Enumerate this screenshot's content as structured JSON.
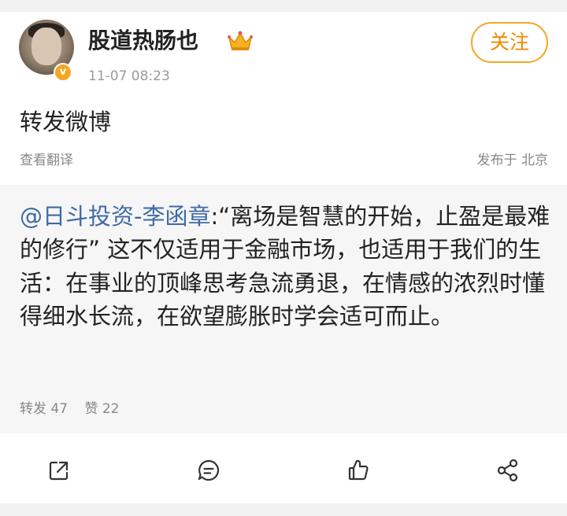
{
  "post": {
    "username": "股道热肠也",
    "timestamp": "11-07 08:23",
    "follow_label": "关注",
    "text": "转发微博",
    "translate_label": "查看翻译",
    "location": "发布于 北京"
  },
  "repost": {
    "mention": "@日斗投资-李函章",
    "body": ":“离场是智慧的开始，止盈是最难的修行” 这不仅适用于金融市场，也适用于我们的生活：在事业的顶峰思考急流勇退，在情感的浓烈时懂得细水长流，在欲望膨胀时学会适可而止。",
    "reposts_label": "转发 47",
    "likes_label": "赞 22"
  },
  "actions": {
    "icons": [
      "share-external-icon",
      "comment-icon",
      "like-icon",
      "share-icon"
    ]
  },
  "colors": {
    "accent": "#f5a623",
    "link": "#3f6aa5",
    "background": "#f2f2f2"
  }
}
